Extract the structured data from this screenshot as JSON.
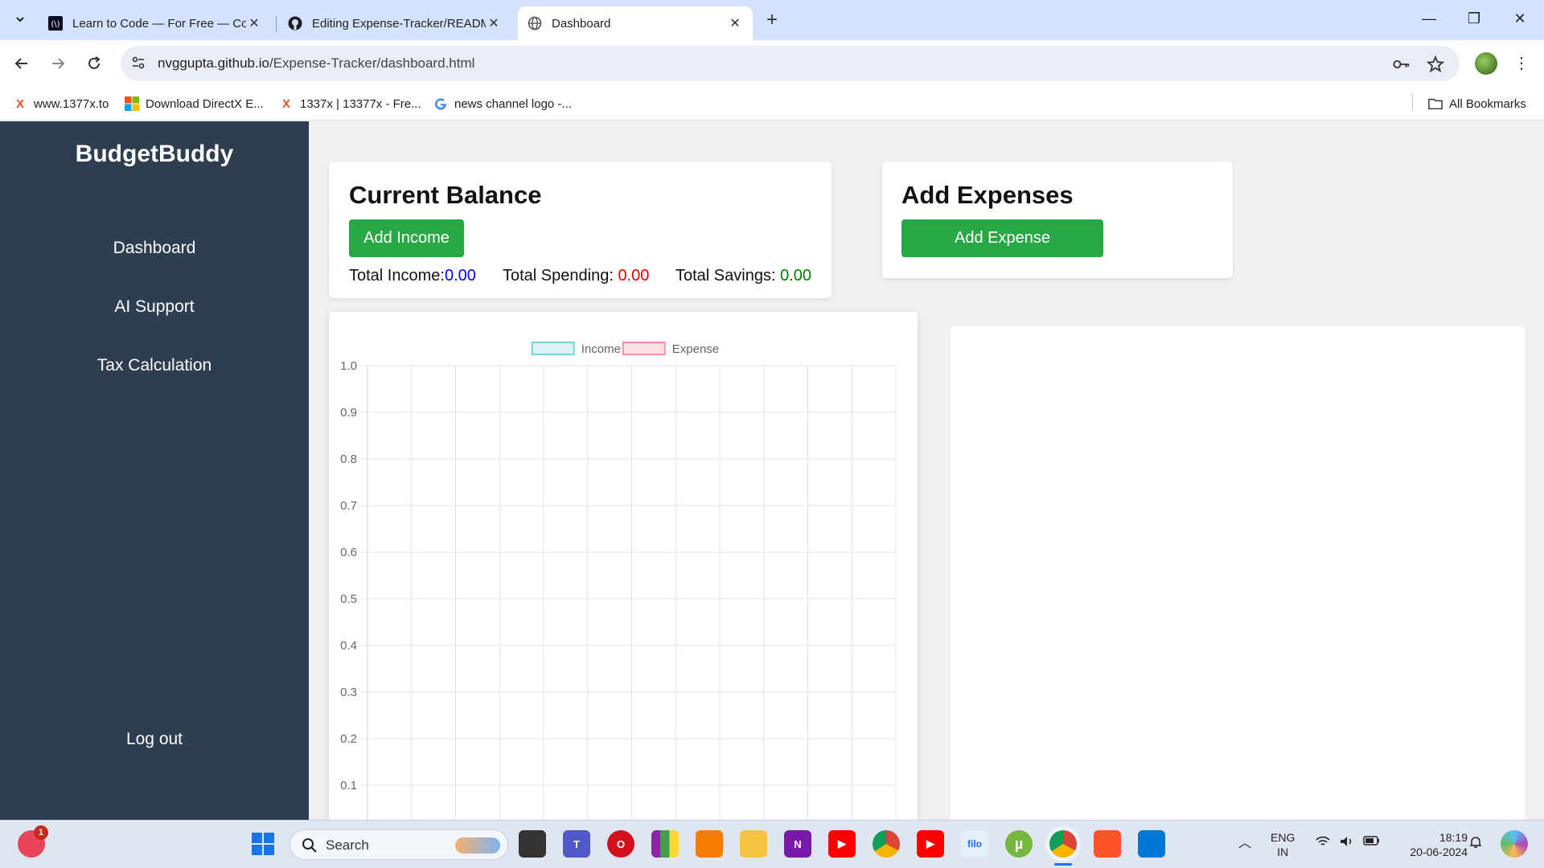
{
  "browser": {
    "tabs": [
      {
        "title": "Learn to Code — For Free — Co",
        "icon": "freecodecamp-icon",
        "close": "✕"
      },
      {
        "title": "Editing Expense-Tracker/READM",
        "icon": "github-icon",
        "close": "✕"
      },
      {
        "title": "Dashboard",
        "icon": "globe-icon",
        "close": "✕"
      }
    ],
    "new_tab": "+",
    "window_controls": {
      "minimize": "—",
      "restore": "❐",
      "close": "✕"
    },
    "url_host": "nvggupta.github.io",
    "url_path": "/Expense-Tracker/dashboard.html",
    "bookmarks": [
      {
        "label": "www.1377x.to",
        "icon": "x-logo-icon"
      },
      {
        "label": "Download DirectX E...",
        "icon": "microsoft-icon"
      },
      {
        "label": "1337x | 13377x - Fre...",
        "icon": "x-logo-icon"
      },
      {
        "label": "news channel logo -...",
        "icon": "google-icon"
      }
    ],
    "all_bookmarks": "All Bookmarks"
  },
  "sidebar": {
    "brand": "BudgetBuddy",
    "items": [
      {
        "label": "Dashboard"
      },
      {
        "label": "AI Support"
      },
      {
        "label": "Tax Calculation"
      }
    ],
    "logout": "Log out"
  },
  "balance_card": {
    "title": "Current Balance",
    "add_income_label": "Add Income",
    "total_income_label": "Total Income:",
    "total_income_value": "0.00",
    "total_spending_label": "Total Spending: ",
    "total_spending_value": "0.00",
    "total_savings_label": "Total Savings: ",
    "total_savings_value": "0.00"
  },
  "expenses_card": {
    "title": "Add Expenses",
    "add_expense_label": "Add Expense"
  },
  "chart_data": {
    "type": "bar",
    "categories": [],
    "series": [
      {
        "name": "Income",
        "values": [],
        "color": "#4bc0c0"
      },
      {
        "name": "Expense",
        "values": [],
        "color": "#ff6384"
      }
    ],
    "ylim": [
      0,
      1.0
    ],
    "yticks": [
      "1.0",
      "0.9",
      "0.8",
      "0.7",
      "0.6",
      "0.5",
      "0.4",
      "0.3",
      "0.2",
      "0.1"
    ],
    "x_gridlines": 12,
    "grid": true,
    "legend": "top-center"
  },
  "colors": {
    "sidebar_bg": "#2c3e50",
    "button_green": "#28a745",
    "income_blue": "#0000ff",
    "spending_red": "#e00000",
    "savings_green": "#008000"
  },
  "taskbar": {
    "search_label": "Search",
    "notification_badge": "1",
    "lang_top": "ENG",
    "lang_bottom": "IN",
    "time": "18:19",
    "date": "20-06-2024",
    "apps": [
      {
        "name": "windows-start-icon",
        "label": ""
      },
      {
        "name": "task-view-icon",
        "label": ""
      },
      {
        "name": "teams-icon",
        "label": "T"
      },
      {
        "name": "opera-icon",
        "label": "O"
      },
      {
        "name": "winrar-icon",
        "label": ""
      },
      {
        "name": "paint-icon",
        "label": ""
      },
      {
        "name": "file-explorer-icon",
        "label": ""
      },
      {
        "name": "onenote-icon",
        "label": "N"
      },
      {
        "name": "youtube-icon",
        "label": "▶"
      },
      {
        "name": "chrome-icon",
        "label": ""
      },
      {
        "name": "youtube-icon-2",
        "label": "▶"
      },
      {
        "name": "filo-icon",
        "label": "filo"
      },
      {
        "name": "utorrent-icon",
        "label": "µ"
      },
      {
        "name": "chrome-active-icon",
        "label": ""
      },
      {
        "name": "brave-icon",
        "label": ""
      },
      {
        "name": "vscode-icon",
        "label": ""
      }
    ]
  }
}
